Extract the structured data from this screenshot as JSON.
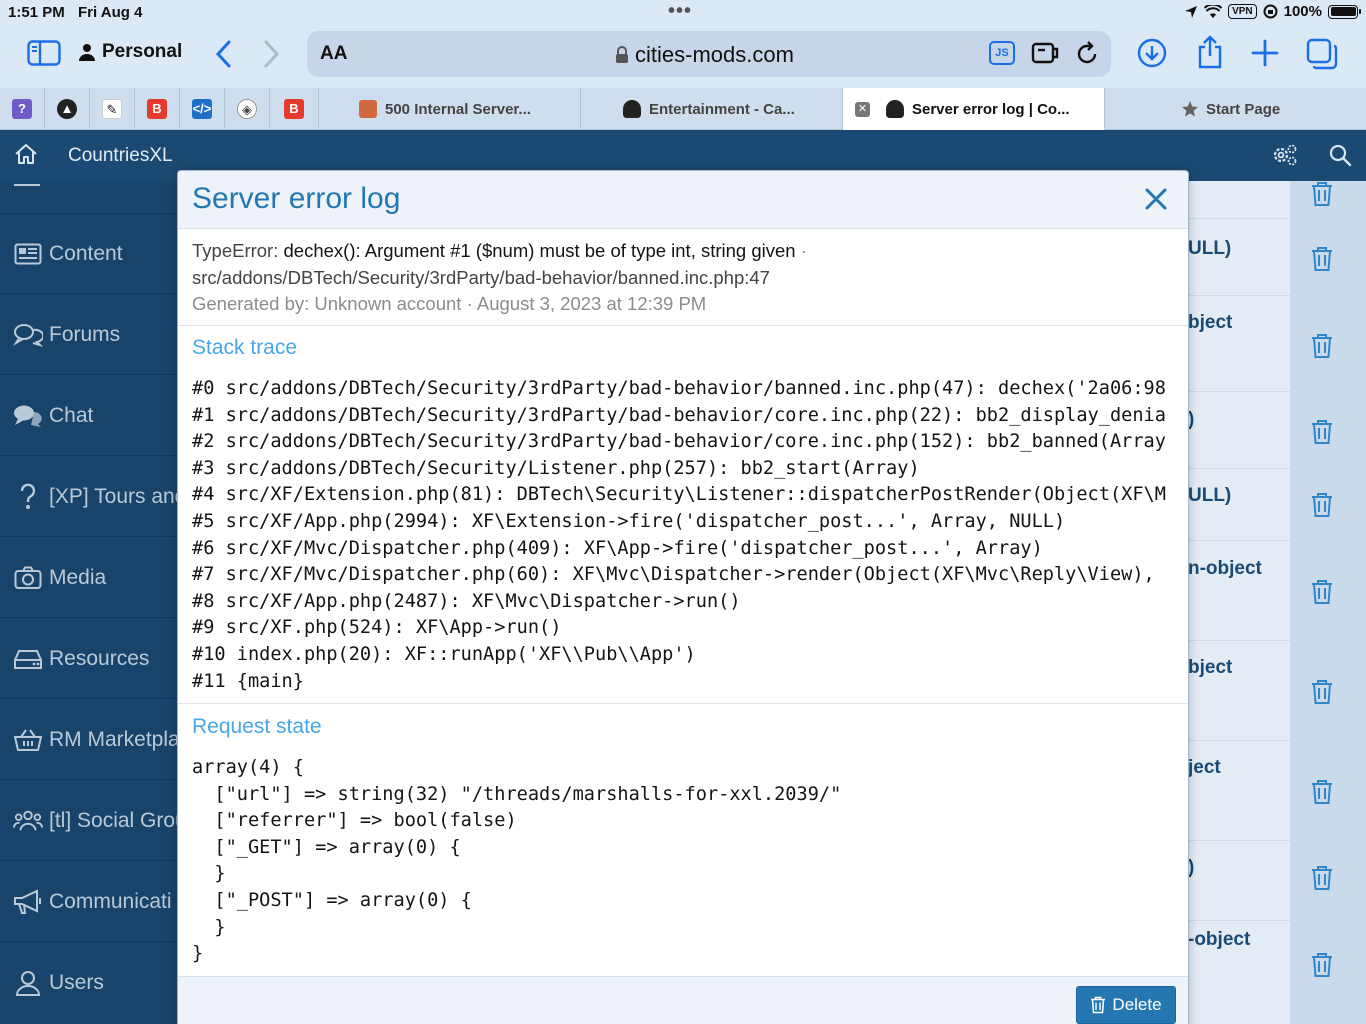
{
  "status": {
    "time": "1:51 PM",
    "date": "Fri Aug 4",
    "dots": "•••",
    "vpn": "VPN",
    "battery": "100%"
  },
  "toolbar": {
    "profile": "Personal",
    "text_size": "AA",
    "url": "cities-mods.com",
    "js_badge": "JS"
  },
  "tabs": [
    {
      "label": "500 Internal Server...",
      "active": false
    },
    {
      "label": "Entertainment - Ca...",
      "active": false
    },
    {
      "label": "Server error log | Co...",
      "active": true
    },
    {
      "label": "Start Page",
      "active": false
    }
  ],
  "site": {
    "name": "CountriesXL"
  },
  "sidebar": {
    "items": [
      {
        "label": "Content",
        "icon": "newspaper-icon"
      },
      {
        "label": "Forums",
        "icon": "comments-icon"
      },
      {
        "label": "Chat",
        "icon": "chat-icon"
      },
      {
        "label": "[XP] Tours and",
        "icon": "question-icon"
      },
      {
        "label": "Media",
        "icon": "camera-icon"
      },
      {
        "label": "Resources",
        "icon": "hdd-icon"
      },
      {
        "label": "RM Marketpla",
        "icon": "basket-icon"
      },
      {
        "label": "[tl] Social Grou",
        "icon": "users-icon"
      },
      {
        "label": "Communicati",
        "icon": "megaphone-icon"
      },
      {
        "label": "Users",
        "icon": "user-icon"
      }
    ]
  },
  "background_rows": [
    "ULL)",
    "bject",
    ")",
    "ULL)",
    "n-object",
    "bject",
    "ject",
    ")",
    "-object"
  ],
  "modal": {
    "title": "Server error log",
    "error_type": "TypeError:",
    "error_message": "dechex(): Argument #1 ($num) must be of type int, string given",
    "error_file": "src/addons/DBTech/Security/3rdParty/bad-behavior/banned.inc.php:47",
    "generated_by": "Generated by: Unknown account · August 3, 2023 at 12:39 PM",
    "stack_title": "Stack trace",
    "stack": [
      "#0 src/addons/DBTech/Security/3rdParty/bad-behavior/banned.inc.php(47): dechex('2a06:98",
      "#1 src/addons/DBTech/Security/3rdParty/bad-behavior/core.inc.php(22): bb2_display_denia",
      "#2 src/addons/DBTech/Security/3rdParty/bad-behavior/core.inc.php(152): bb2_banned(Array",
      "#3 src/addons/DBTech/Security/Listener.php(257): bb2_start(Array)",
      "#4 src/XF/Extension.php(81): DBTech\\Security\\Listener::dispatcherPostRender(Object(XF\\M",
      "#5 src/XF/App.php(2994): XF\\Extension->fire('dispatcher_post...', Array, NULL)",
      "#6 src/XF/Mvc/Dispatcher.php(409): XF\\App->fire('dispatcher_post...', Array)",
      "#7 src/XF/Mvc/Dispatcher.php(60): XF\\Mvc\\Dispatcher->render(Object(XF\\Mvc\\Reply\\View),",
      "#8 src/XF/App.php(2487): XF\\Mvc\\Dispatcher->run()",
      "#9 src/XF.php(524): XF\\App->run()",
      "#10 index.php(20): XF::runApp('XF\\\\Pub\\\\App')",
      "#11 {main}"
    ],
    "request_title": "Request state",
    "request": [
      "array(4) {",
      "  [\"url\"] => string(32) \"/threads/marshalls-for-xxl.2039/\"",
      "  [\"referrer\"] => bool(false)",
      "  [\"_GET\"] => array(0) {",
      "  }",
      "  [\"_POST\"] => array(0) {",
      "  }",
      "}"
    ],
    "delete_label": "Delete"
  },
  "colors": {
    "accent": "#2577b1",
    "sidebar": "#18446b",
    "header": "#1a4a73",
    "safari_blue": "#1a6ee8"
  }
}
